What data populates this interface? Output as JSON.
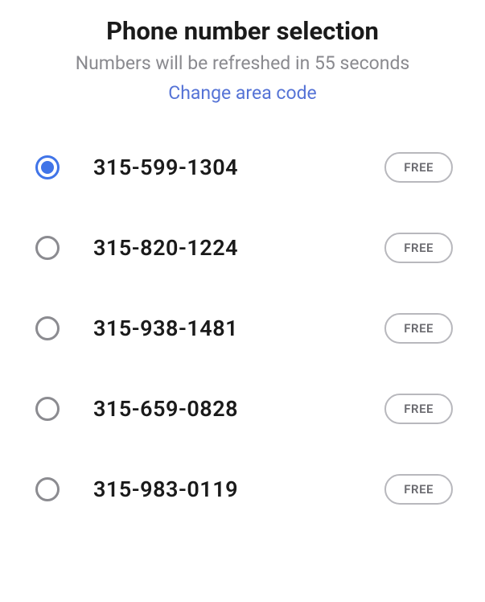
{
  "header": {
    "title": "Phone number selection",
    "subtitle": "Numbers will be refreshed in 55 seconds",
    "change_link": "Change area code"
  },
  "numbers": [
    {
      "number": "315-599-1304",
      "badge": "FREE",
      "selected": true
    },
    {
      "number": "315-820-1224",
      "badge": "FREE",
      "selected": false
    },
    {
      "number": "315-938-1481",
      "badge": "FREE",
      "selected": false
    },
    {
      "number": "315-659-0828",
      "badge": "FREE",
      "selected": false
    },
    {
      "number": "315-983-0119",
      "badge": "FREE",
      "selected": false
    }
  ]
}
